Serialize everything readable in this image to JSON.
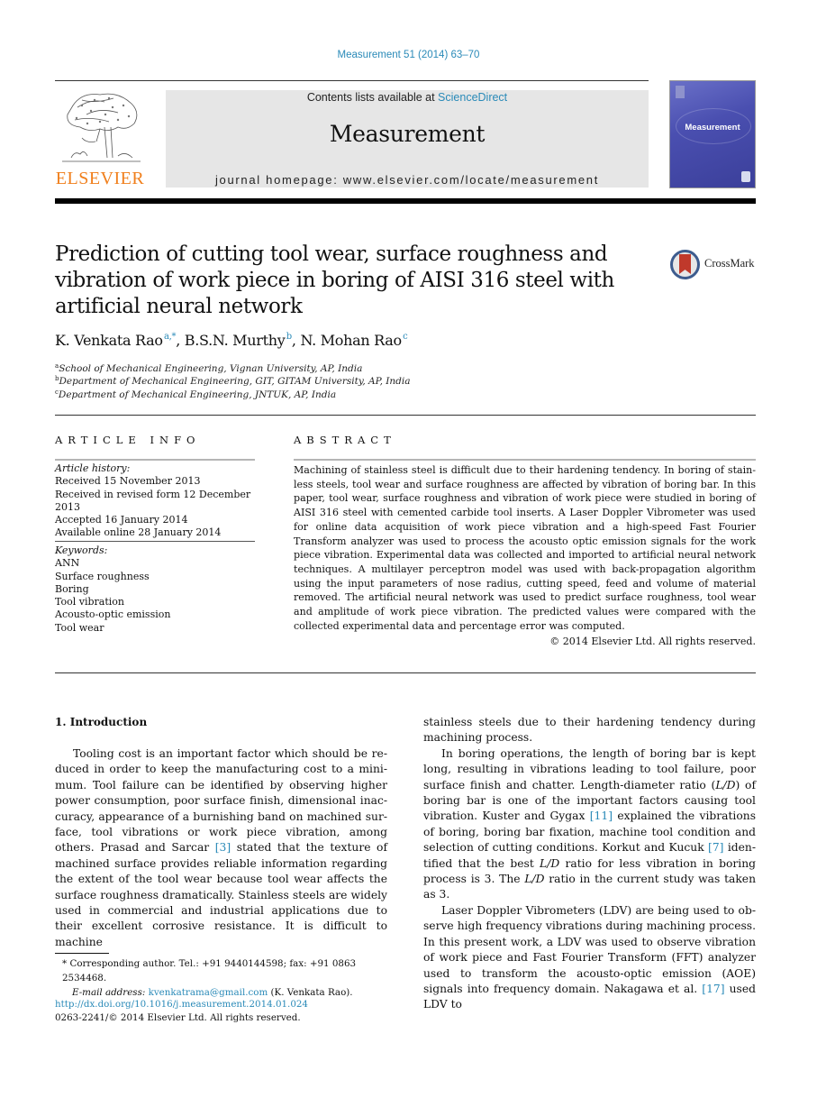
{
  "header": {
    "journal_ref": "Measurement 51 (2014) 63–70",
    "contents_prefix": "Contents lists available at ",
    "contents_link": "ScienceDirect",
    "journal_title": "Measurement",
    "homepage_line": "journal homepage: www.elsevier.com/locate/measurement",
    "publisher_logo_text": "ELSEVIER",
    "cover_title": "Measurement",
    "crossmark_label": "CrossMark"
  },
  "article": {
    "title": "Prediction of cutting tool wear, surface roughness and vibration of work piece in boring of AISI 316 steel with artificial neural network",
    "authors": [
      {
        "name": "K. Venkata Rao",
        "sup": "a,*"
      },
      {
        "name": "B.S.N. Murthy",
        "sup": "b"
      },
      {
        "name": "N. Mohan Rao",
        "sup": "c"
      }
    ],
    "author_separator": ", ",
    "affiliations": [
      {
        "mark": "a",
        "text": "School of Mechanical Engineering, Vignan University, AP, India"
      },
      {
        "mark": "b",
        "text": "Department of Mechanical Engineering, GIT, GITAM University, AP, India"
      },
      {
        "mark": "c",
        "text": "Department of Mechanical Engineering, JNTUK, AP, India"
      }
    ]
  },
  "article_info": {
    "section_label": "ARTICLE INFO",
    "history_label": "Article history:",
    "history": [
      "Received 15 November 2013",
      "Received in revised form 12 December 2013",
      "Accepted 16 January 2014",
      "Available online 28 January 2014"
    ],
    "keywords_label": "Keywords:",
    "keywords": [
      "ANN",
      "Surface roughness",
      "Boring",
      "Tool vibration",
      "Acousto-optic emission",
      "Tool wear"
    ]
  },
  "abstract": {
    "section_label": "ABSTRACT",
    "text": "Machining of stainless steel is difficult due to their hardening tendency. In boring of stain­less steels, tool wear and surface roughness are affected by vibration of boring bar. In this paper, tool wear, surface roughness and vibration of work piece were studied in boring of AISI 316 steel with cemented carbide tool inserts. A Laser Doppler Vibrometer was used for online data acquisition of work piece vibration and a high-speed Fast Fourier Transform analyzer was used to process the acousto optic emission signals for the work piece vibra­tion. Experimental data was collected and imported to artificial neural network techniques. A multilayer perceptron model was used with back-propagation algorithm using the input parameters of nose radius, cutting speed, feed and volume of material removed. The arti­ficial neural network was used to predict surface roughness, tool wear and amplitude of work piece vibration. The predicted values were compared with the collected experimental data and percentage error was computed.",
    "copyright": "© 2014 Elsevier Ltd. All rights reserved."
  },
  "introduction": {
    "heading": "1. Introduction",
    "left_column": {
      "p1_a": "Tooling cost is an important factor which should be re­duced in order to keep the manufacturing cost to a mini­mum. Tool failure can be identified by observing higher power consumption, poor surface finish, dimensional inac­curacy, appearance of a burnishing band on machined sur­face, tool vibrations or work piece vibration, among others. Prasad and Sarcar ",
      "p1_ref": "[3]",
      "p1_b": " stated that the texture of machined surface provides reliable information regarding the extent of the tool wear because tool wear affects the surface roughness dramatically. Stainless steels are widely used in commercial and industrial applications due to their excellent corrosive resistance. It is difficult to machine"
    },
    "right_column": {
      "p0": "stainless steels due to their hardening tendency during machining process.",
      "p2_a": "In boring operations, the length of boring bar is kept long, resulting in vibrations leading to tool failure, poor surface finish and chatter. Length-diameter ratio (",
      "ld": "L/D",
      "p2_b": ") of boring bar is one of the important factors causing tool vibration. Kuster and Gygax ",
      "p2_ref1": "[11]",
      "p2_c": " explained the vibrations of boring, boring bar fixation, machine tool condition and selection of cutting conditions. Korkut and Kucuk ",
      "p2_ref2": "[7]",
      "p2_d": " iden­tified that the best ",
      "p2_e": " ratio for less vibration in boring pro­cess is 3. The ",
      "p2_f": " ratio in the current study was taken as 3.",
      "p3_a": "Laser Doppler Vibrometers (LDV) are being used to ob­serve high frequency vibrations during machining process. In this present work, a LDV was used to observe vibration of work piece and Fast Fourier Transform (FFT) analyzer used to transform the acousto-optic emission (AOE) signals into frequency domain. Nakagawa et al. ",
      "p3_ref": "[17]",
      "p3_b": " used LDV to"
    }
  },
  "footnote": {
    "marker": "*",
    "corresponding": "Corresponding author. Tel.: +91 9440144598; fax: +91 0863 2534468.",
    "email_label": "E-mail address:",
    "email": "kvenkatrama@gmail.com",
    "email_suffix": " (K. Venkata Rao).",
    "doi": "http://dx.doi.org/10.1016/j.measurement.2014.01.024",
    "issn": "0263-2241/© 2014 Elsevier Ltd. All rights reserved."
  },
  "colors": {
    "link": "#2a8ab8",
    "elsevier_orange": "#f07f1c",
    "header_box": "#e6e6e6",
    "cover_blue": "#4a4fb0",
    "crossmark_red": "#c0392b"
  }
}
